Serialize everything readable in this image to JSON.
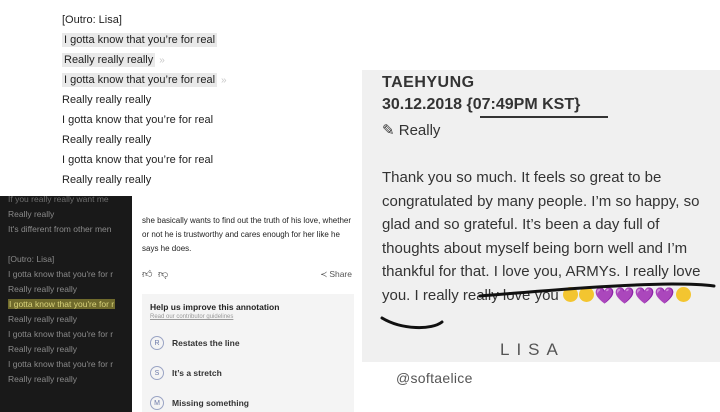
{
  "lyrics_top": [
    {
      "text": "[Outro: Lisa]",
      "highlight": false,
      "chevron": false
    },
    {
      "text": "I gotta know that you’re for real",
      "highlight": true,
      "chevron": false
    },
    {
      "text": "Really really really",
      "highlight": true,
      "chevron": true
    },
    {
      "text": "I gotta know that you’re for real",
      "highlight": true,
      "chevron": true
    },
    {
      "text": "Really really really",
      "highlight": false,
      "chevron": false
    },
    {
      "text": "I gotta know that you’re for real",
      "highlight": false,
      "chevron": false
    },
    {
      "text": "Really really really",
      "highlight": false,
      "chevron": false
    },
    {
      "text": "I gotta know that you’re for real",
      "highlight": false,
      "chevron": false
    },
    {
      "text": "Really really really",
      "highlight": false,
      "chevron": false
    }
  ],
  "dark_lyrics": [
    "If you really really want me",
    "Really really",
    "It's different from other men",
    "",
    "[Outro: Lisa]",
    "I gotta know that you're for r",
    "Really really really",
    "I gotta know that you're for r",
    "Really really really",
    "I gotta know that you're for r",
    "Really really really",
    "I gotta know that you're for r",
    "Really really really"
  ],
  "annotation": {
    "text": "she basically wants to find out the truth of his love, whether or not he is trustworthy and cares enough for her like he says he does.",
    "share_label": "Share",
    "feedback_title": "Help us improve this annotation",
    "feedback_guidelines": "Read our contributor guidelines",
    "options": [
      {
        "letter": "R",
        "label": "Restates the line"
      },
      {
        "letter": "S",
        "label": "It’s a stretch"
      },
      {
        "letter": "M",
        "label": "Missing something"
      }
    ]
  },
  "message": {
    "author": "TAEHYUNG",
    "date": "30.12.2018 {07:49PM KST}",
    "topic": "✎ Really",
    "body": "Thank you so much. It feels so great to be congratulated by many people. I’m so happy, so glad and so grateful. It’s been a day full of thoughts about myself being born well and I’m thankful for that. I love you, ARMYs. I really love you. I really really love you",
    "purple_hearts": "💜💜💜💜",
    "signature": "LISA"
  },
  "credit": "@softaelice",
  "colors": {
    "dark_panel": "#191919",
    "message_bg": "#f0f0f0",
    "highlight_yellow": "#6f6a2c",
    "heart_purple": "#9b3fd9",
    "emoji_yellow": "#f3c530"
  }
}
